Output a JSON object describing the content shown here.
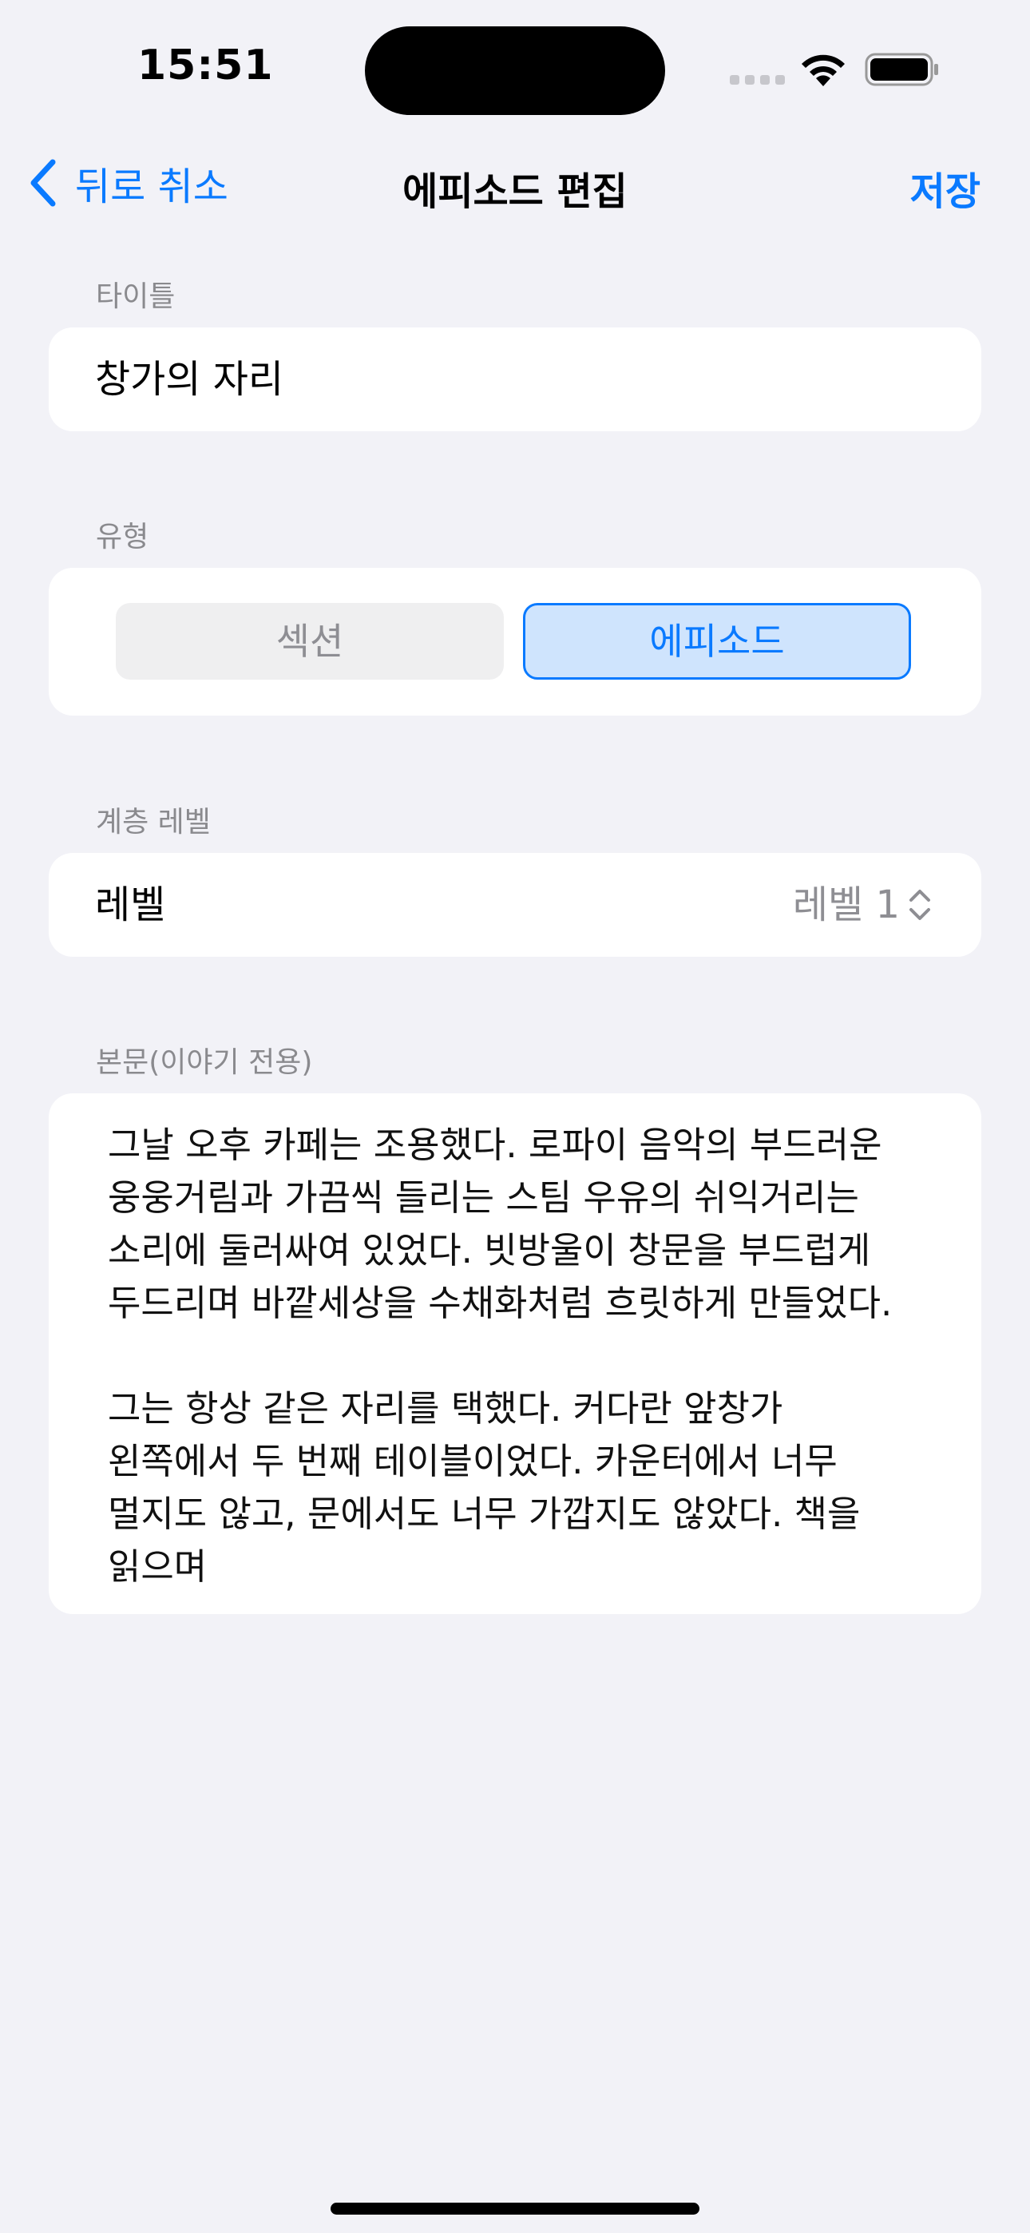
{
  "status_bar": {
    "time": "15:51",
    "icons": [
      "cellular-icon",
      "wifi-icon",
      "battery-icon"
    ]
  },
  "nav": {
    "back_label": "뒤로 취소",
    "title": "에피소드 편집",
    "save_label": "저장"
  },
  "title_section": {
    "label": "타이틀",
    "value": "창가의 자리"
  },
  "type_section": {
    "label": "유형",
    "options": [
      "섹션",
      "에피소드"
    ],
    "selected": "에피소드"
  },
  "level_section": {
    "label": "계층 레벨",
    "row_label": "레벨",
    "value": "레벨 1"
  },
  "body_section": {
    "label": "본문(이야기 전용)",
    "text": "그날 오후 카페는 조용했다. 로파이 음악의 부드러운 웅웅거림과 가끔씩 들리는 스팀 우유의 쉬익거리는 소리에 둘러싸여 있었다. 빗방울이 창문을 부드럽게 두드리며 바깥세상을 수채화처럼 흐릿하게 만들었다.\n\n그는 항상 같은 자리를 택했다. 커다란 앞창가 왼쪽에서 두 번째 테이블이었다. 카운터에서 너무 멀지도 않고, 문에서도 너무 가깝지도 않았다. 책을 읽으며"
  },
  "colors": {
    "accent": "#0a7aff",
    "background": "#f2f2f7",
    "card": "#ffffff",
    "secondary_text": "#8e8e93"
  }
}
